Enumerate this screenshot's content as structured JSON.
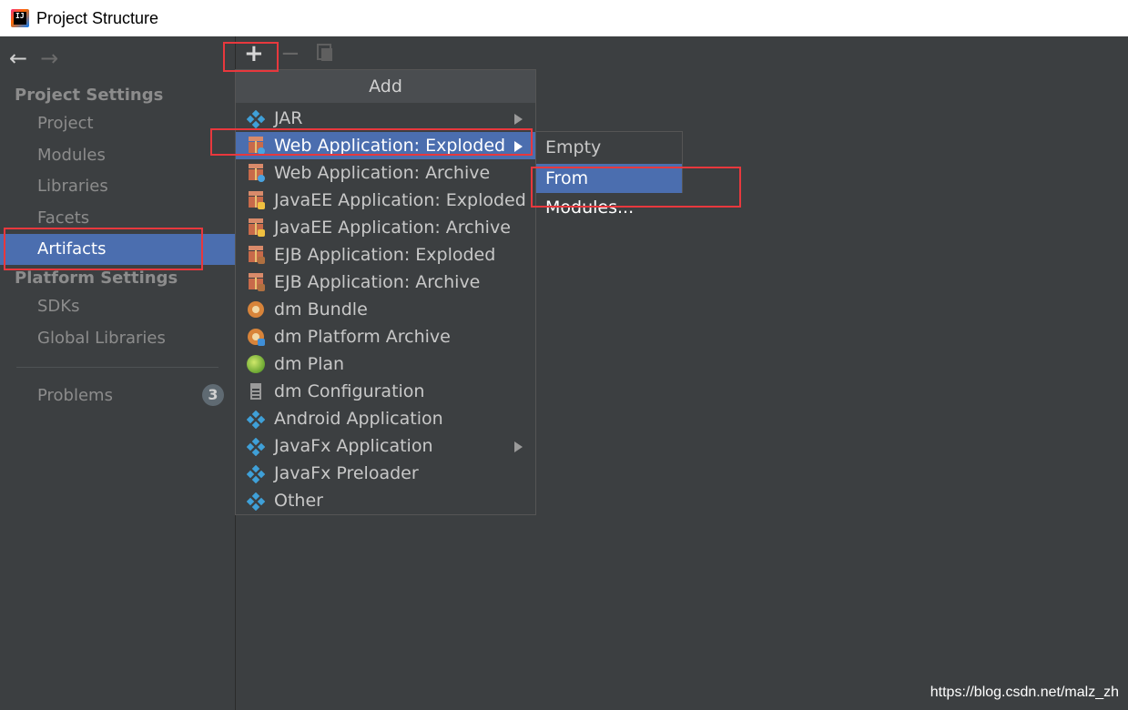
{
  "window": {
    "title": "Project Structure"
  },
  "sidebar": {
    "project_settings_header": "Project Settings",
    "project_items": [
      "Project",
      "Modules",
      "Libraries",
      "Facets",
      "Artifacts"
    ],
    "platform_settings_header": "Platform Settings",
    "platform_items": [
      "SDKs",
      "Global Libraries"
    ],
    "problems_label": "Problems",
    "problems_count": "3",
    "selected_item": "Artifacts"
  },
  "toolbar": {
    "add": "+",
    "remove": "−"
  },
  "add_menu": {
    "title": "Add",
    "items": [
      {
        "label": "JAR",
        "icon": "diamond-icon",
        "submenu": true
      },
      {
        "label": "Web Application: Exploded",
        "icon": "web-gift-icon",
        "submenu": true,
        "active": true
      },
      {
        "label": "Web Application: Archive",
        "icon": "web-gift-icon",
        "submenu": false
      },
      {
        "label": "JavaEE Application: Exploded",
        "icon": "javaee-gift-icon",
        "submenu": false
      },
      {
        "label": "JavaEE Application: Archive",
        "icon": "javaee-gift-icon",
        "submenu": false
      },
      {
        "label": "EJB Application: Exploded",
        "icon": "ejb-gift-icon",
        "submenu": false
      },
      {
        "label": "EJB Application: Archive",
        "icon": "ejb-gift-icon",
        "submenu": false
      },
      {
        "label": "dm Bundle",
        "icon": "bundle-icon",
        "submenu": false
      },
      {
        "label": "dm Platform Archive",
        "icon": "platform-archive-icon",
        "submenu": false
      },
      {
        "label": "dm Plan",
        "icon": "plan-icon",
        "submenu": false
      },
      {
        "label": "dm Configuration",
        "icon": "document-icon",
        "submenu": false
      },
      {
        "label": "Android Application",
        "icon": "diamond-icon",
        "submenu": false
      },
      {
        "label": "JavaFx Application",
        "icon": "diamond-icon",
        "submenu": true
      },
      {
        "label": "JavaFx Preloader",
        "icon": "diamond-icon",
        "submenu": false
      },
      {
        "label": "Other",
        "icon": "diamond-icon",
        "submenu": false
      }
    ]
  },
  "submenu": {
    "items": [
      {
        "label": "Empty",
        "active": false
      },
      {
        "label": "From Modules...",
        "active": true
      }
    ]
  },
  "watermark": "https://blog.csdn.net/malz_zh",
  "colors": {
    "selection": "#4b6eaf",
    "highlight": "#e8383d",
    "background": "#3c3f41"
  }
}
